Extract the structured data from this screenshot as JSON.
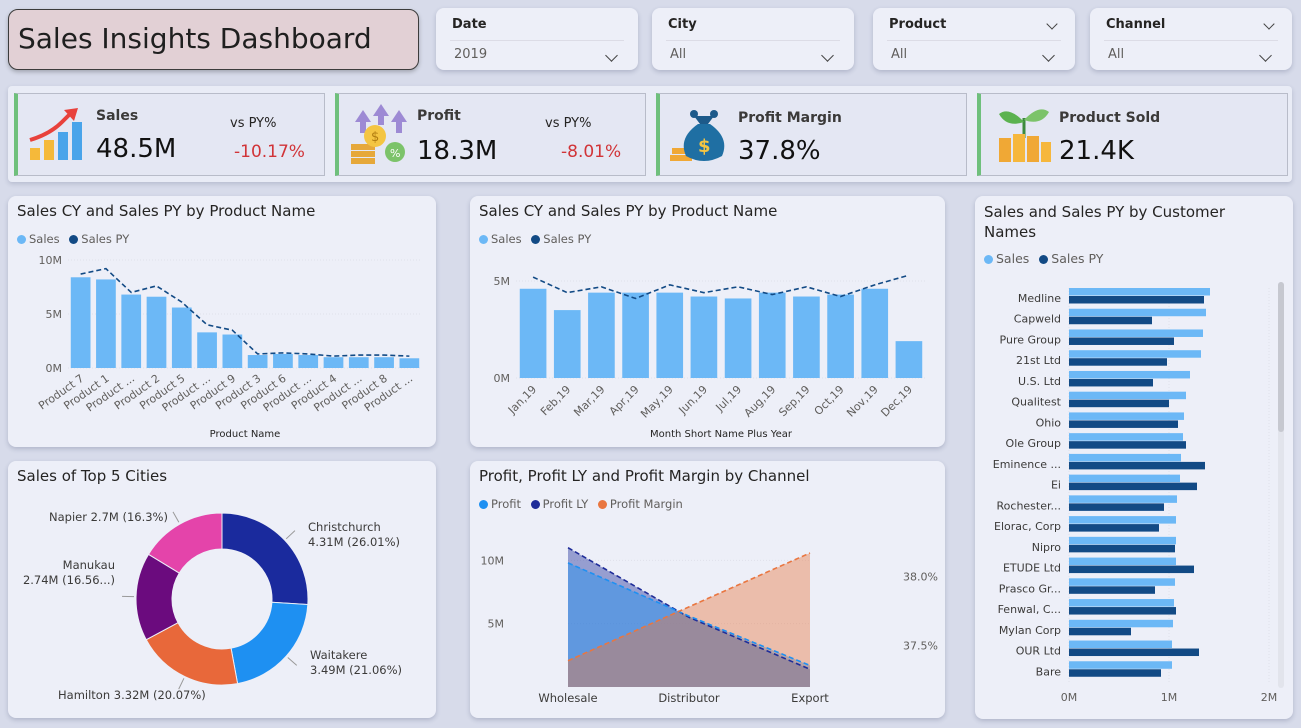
{
  "header": {
    "title": "Sales Insights Dashboard"
  },
  "slicers": [
    {
      "label": "Date",
      "value": "2019"
    },
    {
      "label": "City",
      "value": "All"
    },
    {
      "label": "Product",
      "value": "All"
    },
    {
      "label": "Channel",
      "value": "All"
    }
  ],
  "kpis": {
    "sales": {
      "label": "Sales",
      "value": "48.5M",
      "vs_label": "vs PY%",
      "vs_value": "-10.17%"
    },
    "profit": {
      "label": "Profit",
      "value": "18.3M",
      "vs_label": "vs PY%",
      "vs_value": "-8.01%"
    },
    "margin": {
      "label": "Profit Margin",
      "value": "37.8%"
    },
    "sold": {
      "label": "Product Sold",
      "value": "21.4K"
    }
  },
  "colors": {
    "sales": "#6cb8f6",
    "sales_py": "#124a85",
    "profit_ly": "#1f2d99",
    "margin": "#e97640",
    "kpi_accent": "#6fc07c",
    "negative": "#d13438"
  },
  "chart_data": [
    {
      "id": "product",
      "type": "bar",
      "title": "Sales CY and Sales PY by Product Name",
      "legend": [
        "Sales",
        "Sales PY"
      ],
      "xlabel": "Product Name",
      "yticks": [
        "0M",
        "5M",
        "10M"
      ],
      "ylim": [
        0,
        10
      ],
      "categories": [
        "Product 7",
        "Product 1",
        "Product ...",
        "Product 2",
        "Product 5",
        "Product ...",
        "Product 9",
        "Product 3",
        "Product 6",
        "Product ...",
        "Product 4",
        "Product ...",
        "Product 8",
        "Product ..."
      ],
      "series": [
        {
          "name": "Sales",
          "values": [
            8.4,
            8.2,
            6.8,
            6.6,
            5.6,
            3.3,
            3.1,
            1.2,
            1.3,
            1.2,
            1.0,
            1.0,
            1.0,
            0.9
          ]
        },
        {
          "name": "Sales PY",
          "values": [
            8.7,
            9.2,
            7.0,
            7.6,
            6.1,
            4.0,
            3.5,
            1.3,
            1.4,
            1.3,
            1.1,
            1.2,
            1.2,
            1.1
          ]
        }
      ]
    },
    {
      "id": "month",
      "type": "bar",
      "title": "Sales CY and Sales PY by Product Name",
      "legend": [
        "Sales",
        "Sales PY"
      ],
      "xlabel": "Month Short Name Plus Year",
      "yticks": [
        "0M",
        "5M"
      ],
      "ylim": [
        0,
        5
      ],
      "categories": [
        "Jan,19",
        "Feb,19",
        "Mar,19",
        "Apr,19",
        "May,19",
        "Jun,19",
        "Jul,19",
        "Aug,19",
        "Sep,19",
        "Oct,19",
        "Nov,19",
        "Dec,19"
      ],
      "series": [
        {
          "name": "Sales",
          "values": [
            4.6,
            3.5,
            4.4,
            4.4,
            4.4,
            4.2,
            4.1,
            4.4,
            4.2,
            4.3,
            4.6,
            1.9
          ]
        },
        {
          "name": "Sales PY",
          "values": [
            5.2,
            4.4,
            4.7,
            4.1,
            4.8,
            4.4,
            4.7,
            4.3,
            4.7,
            4.2,
            4.8,
            5.3
          ]
        }
      ]
    },
    {
      "id": "customer",
      "type": "bar",
      "orientation": "horizontal",
      "title": "Sales and Sales PY by Customer Names",
      "legend": [
        "Sales",
        "Sales PY"
      ],
      "xticks": [
        "0M",
        "1M",
        "2M"
      ],
      "xlim": [
        0,
        2
      ],
      "categories": [
        "Medline",
        "Capweld",
        "Pure Group",
        "21st Ltd",
        "U.S. Ltd",
        "Qualitest",
        "Ohio",
        "Ole Group",
        "Eminence ...",
        "Ei",
        "Rochester...",
        "Elorac, Corp",
        "Nipro",
        "ETUDE Ltd",
        "Prasco Gr...",
        "Fenwal, C...",
        "Mylan Corp",
        "OUR Ltd",
        "Bare"
      ],
      "series": [
        {
          "name": "Sales",
          "values": [
            1.41,
            1.37,
            1.34,
            1.32,
            1.21,
            1.17,
            1.15,
            1.14,
            1.12,
            1.11,
            1.08,
            1.07,
            1.07,
            1.07,
            1.06,
            1.05,
            1.04,
            1.03,
            1.03
          ]
        },
        {
          "name": "Sales PY",
          "values": [
            1.35,
            0.83,
            1.05,
            0.98,
            0.84,
            1.0,
            1.09,
            1.17,
            1.36,
            1.28,
            0.95,
            0.9,
            1.06,
            1.25,
            0.86,
            1.07,
            0.62,
            1.3,
            0.92
          ]
        }
      ]
    },
    {
      "id": "cities",
      "type": "pie",
      "title": "Sales of Top 5 Cities",
      "slices": [
        {
          "name": "Christchurch",
          "value": 4.31,
          "label1": "Christchurch",
          "label2": "4.31M (26.01%)",
          "color": "#1a2a9d"
        },
        {
          "name": "Waitakere",
          "value": 3.49,
          "label1": "Waitakere",
          "label2": "3.49M (21.06%)",
          "color": "#1e90f2"
        },
        {
          "name": "Hamilton",
          "value": 3.32,
          "label1": "Hamilton 3.32M (20.07%)",
          "label2": "",
          "color": "#e8683a"
        },
        {
          "name": "Manukau",
          "value": 2.74,
          "label1": "Manukau",
          "label2": "2.74M (16.56...)",
          "color": "#6b0b7e"
        },
        {
          "name": "Napier",
          "value": 2.7,
          "label1": "Napier 2.7M (16.3%)",
          "label2": "",
          "color": "#e444aa"
        }
      ]
    },
    {
      "id": "channel",
      "type": "area",
      "title": "Profit, Profit LY and Profit Margin by Channel",
      "legend": [
        "Profit",
        "Profit LY",
        "Profit Margin"
      ],
      "categories": [
        "Wholesale",
        "Distributor",
        "Export"
      ],
      "yticks": [
        "5M",
        "10M"
      ],
      "y2ticks": [
        "37.5%",
        "38.0%"
      ],
      "ylim": [
        0,
        12
      ],
      "y2lim": [
        37.2,
        38.3
      ],
      "series": [
        {
          "name": "Profit",
          "values": [
            9.8,
            5.6,
            1.7
          ]
        },
        {
          "name": "Profit LY",
          "values": [
            11.0,
            5.5,
            1.4
          ]
        },
        {
          "name": "Profit Margin",
          "values": [
            37.39,
            37.78,
            38.17
          ]
        }
      ]
    }
  ]
}
